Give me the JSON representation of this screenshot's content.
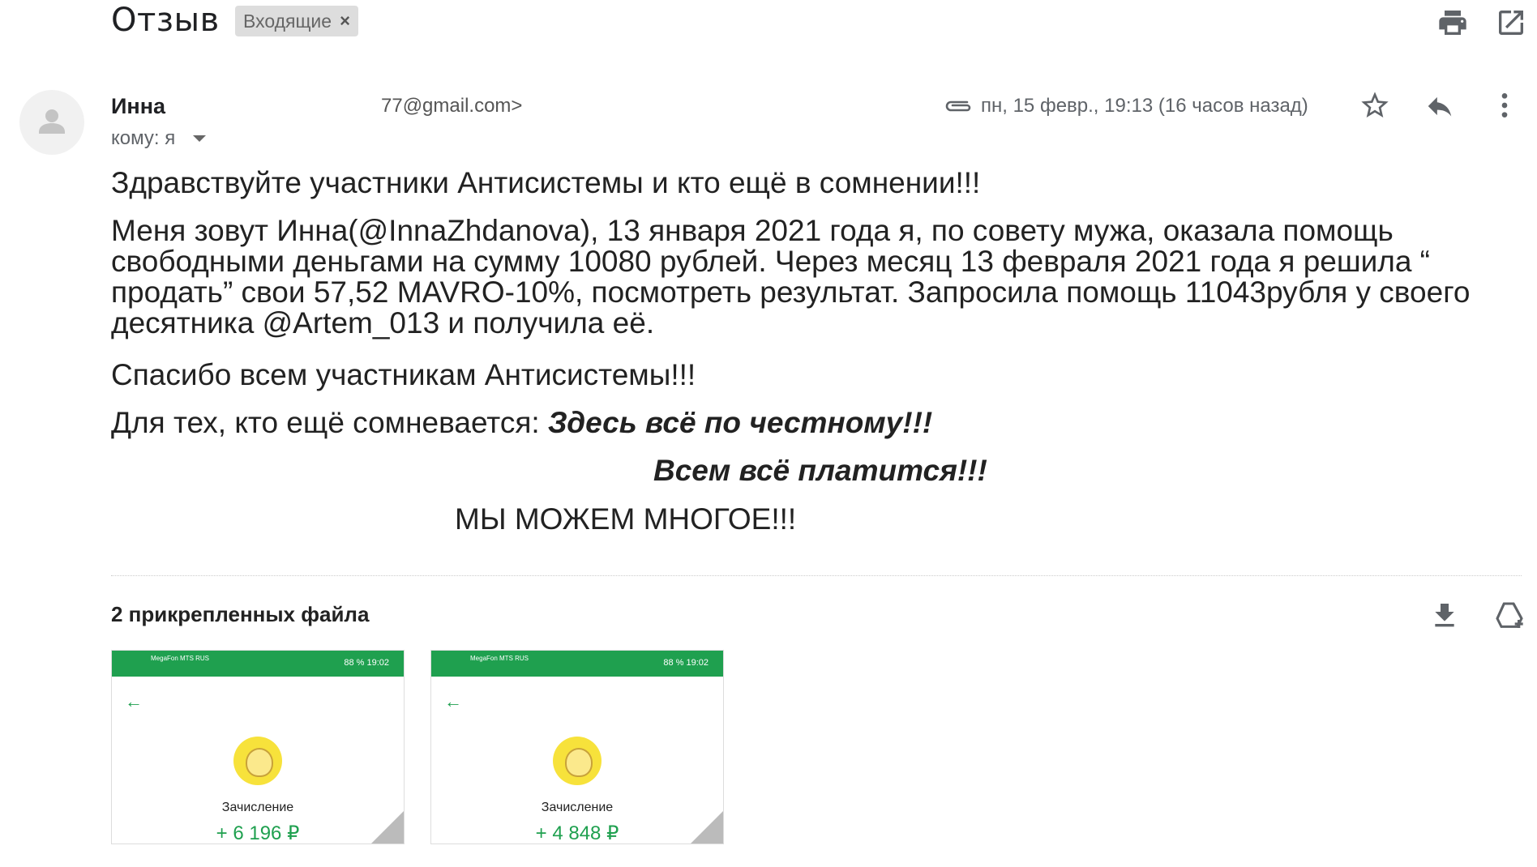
{
  "header": {
    "subject": "Отзыв",
    "label": "Входящие",
    "label_remove": "×"
  },
  "message": {
    "sender_name": "Инна",
    "sender_email": "77@gmail.com>",
    "to_label": "кому: я",
    "date": "пн, 15 февр., 19:13 (16 часов назад)",
    "body": {
      "p1": "Здравствуйте участники Антисистемы и кто ещё в сомнении!!!",
      "p2": "Меня зовут Инна(@InnaZhdanova), 13 января 2021 года я, по совету мужа, оказала помощь свободными деньгами на сумму 10080 рублей. Через месяц 13 февраля 2021 года я решила “ продать” свои 57,52 MAVRO-10%, посмотреть результат. Запросила помощь 11043рубля у своего десятника @Artem_013 и получила её.",
      "p3": "Спасибо всем участникам Антисистемы!!!",
      "p4_prefix": "Для тех, кто ещё сомневается: ",
      "p4_emph": "Здесь всё по честному!!!",
      "p5": "Всем всё платится!!!",
      "p6": "МЫ МОЖЕМ МНОГОЕ!!!"
    }
  },
  "attachments": {
    "title": "2 прикрепленных файла",
    "items": [
      {
        "status_carrier": "MegaFon MTS RUS",
        "status_right": "88 % 19:02",
        "kind": "Зачисление",
        "amount": "+ 6 196 ₽"
      },
      {
        "status_carrier": "MegaFon MTS RUS",
        "status_right": "88 % 19:02",
        "kind": "Зачисление",
        "amount": "+ 4 848 ₽"
      }
    ]
  },
  "colors": {
    "accent_green": "#1fa04f",
    "icon_gray": "#5f6368"
  },
  "icons": [
    "print-icon",
    "open-in-new-window-icon",
    "avatar-person-icon",
    "attachment-clip-icon",
    "star-icon",
    "reply-icon",
    "more-vertical-icon",
    "download-all-icon",
    "save-to-drive-icon",
    "back-arrow-icon"
  ]
}
